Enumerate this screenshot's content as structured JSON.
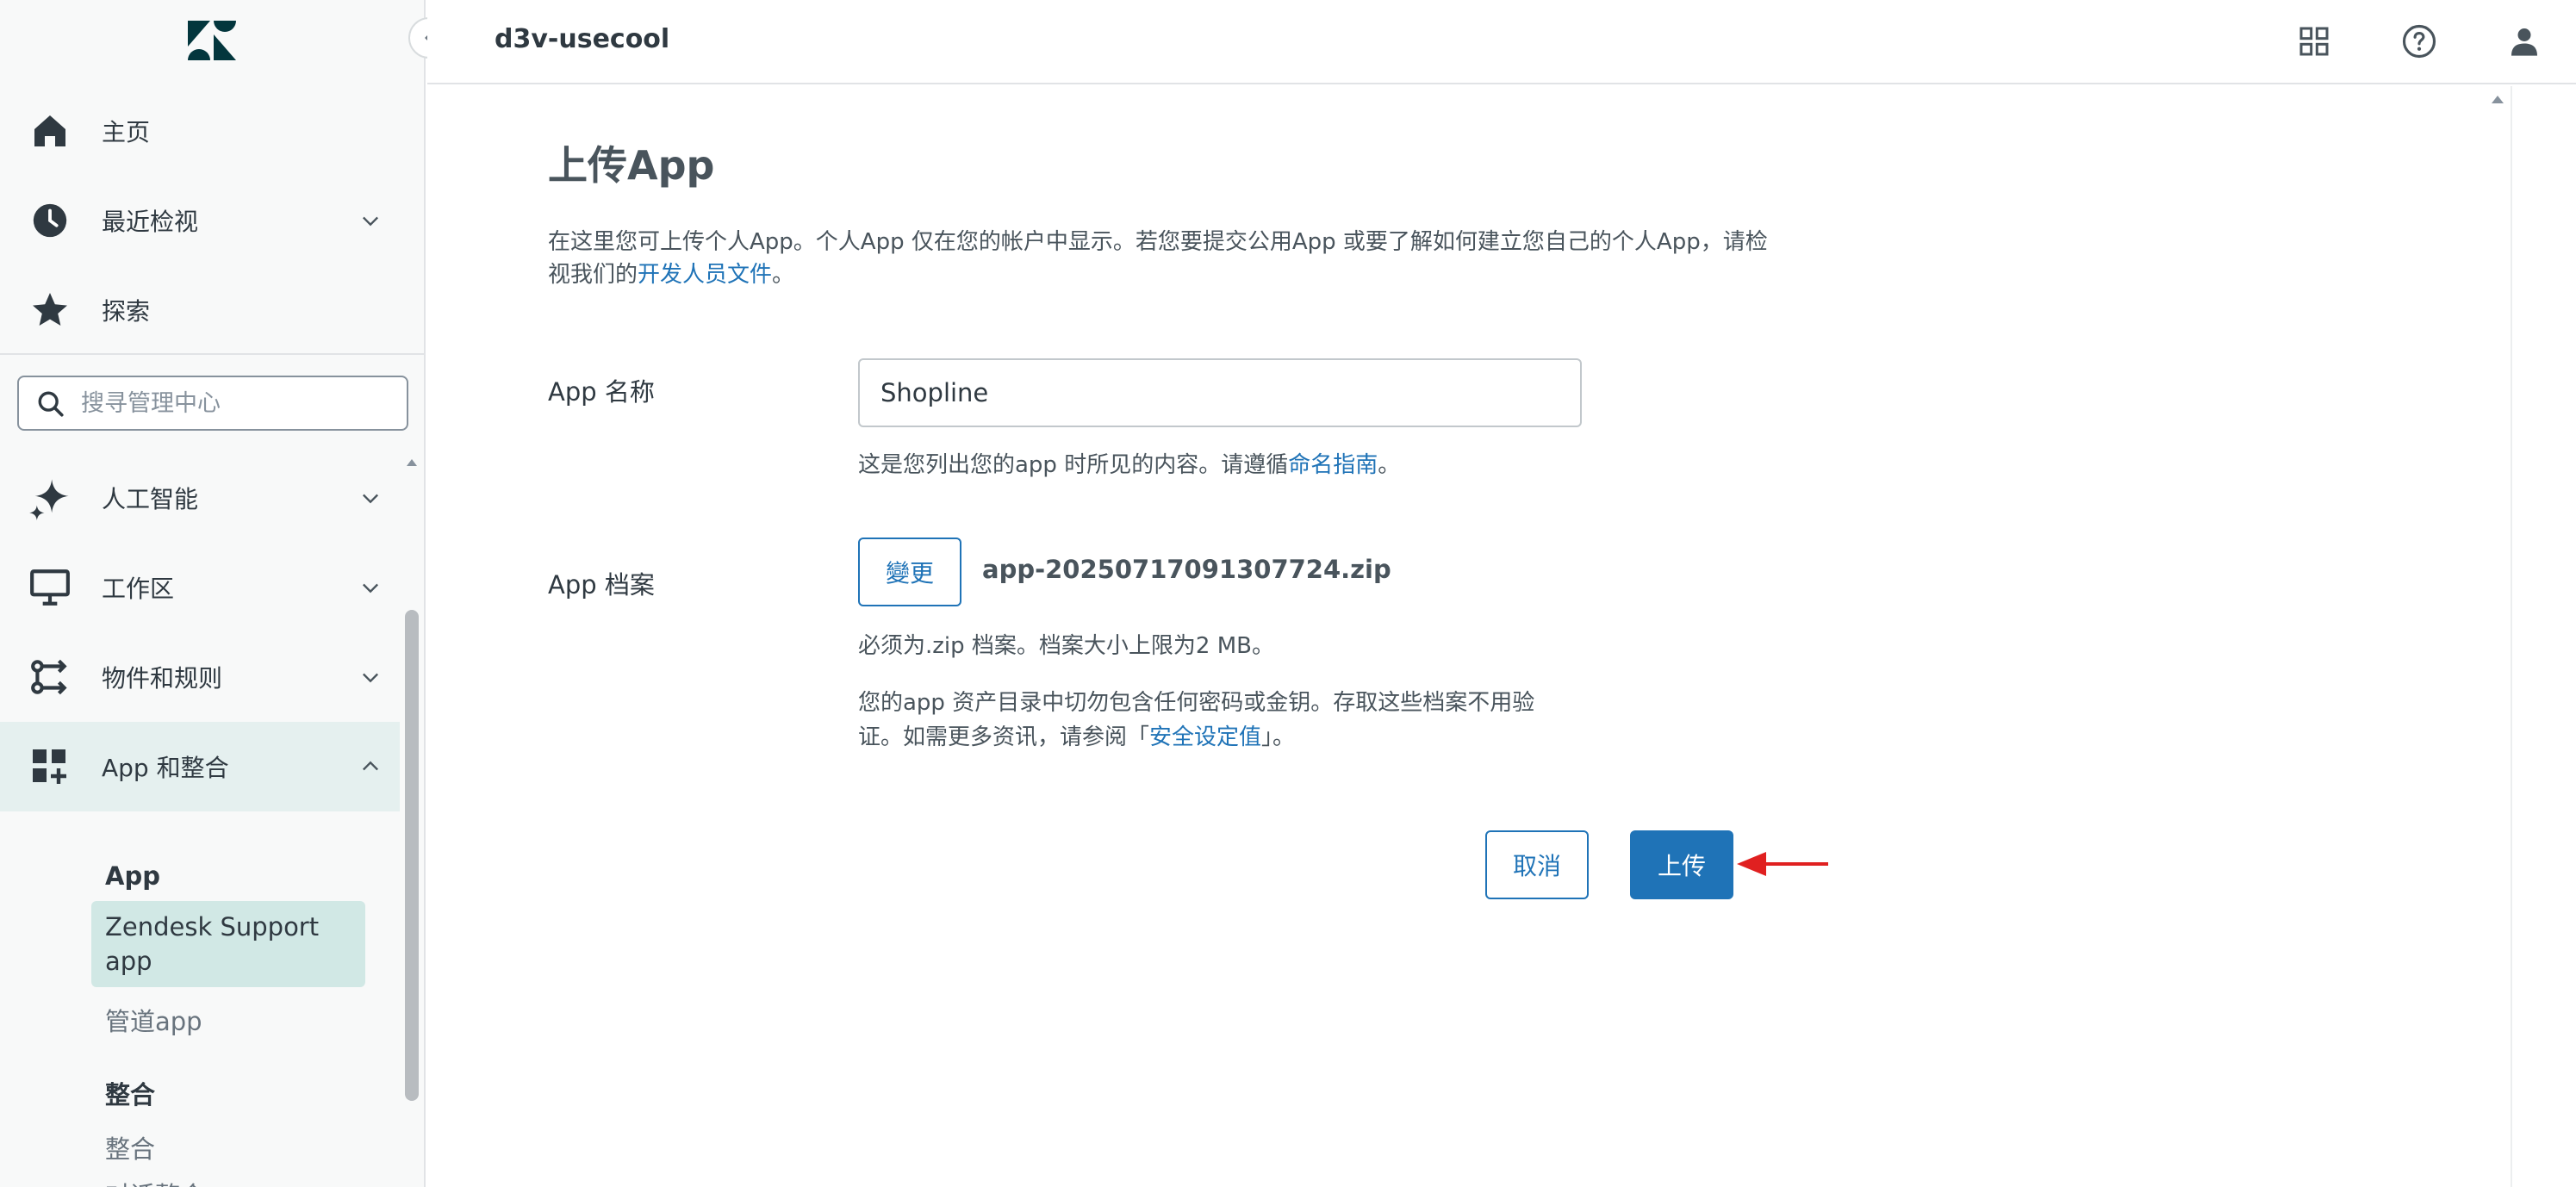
{
  "header": {
    "account_name": "d3v-usecool"
  },
  "sidebar": {
    "nav": [
      {
        "id": "home",
        "label": "主页",
        "icon": "home-icon"
      },
      {
        "id": "recent",
        "label": "最近检视",
        "icon": "clock-icon"
      },
      {
        "id": "explore",
        "label": "探索",
        "icon": "star-icon"
      }
    ],
    "search": {
      "placeholder": "搜寻管理中心"
    },
    "sections": [
      {
        "id": "ai",
        "label": "人工智能",
        "icon": "sparkle-icon"
      },
      {
        "id": "workspace",
        "label": "工作区",
        "icon": "monitor-icon"
      },
      {
        "id": "objects",
        "label": "物件和规则",
        "icon": "routing-icon"
      },
      {
        "id": "apps",
        "label": "App 和整合",
        "icon": "apps-add-icon",
        "expanded": true
      }
    ],
    "apps_group_title": "App",
    "apps_items": [
      "Zendesk Support app",
      "管道app"
    ],
    "integrations_group_title": "整合",
    "integrations_items": [
      "整合",
      "对话整合"
    ]
  },
  "main": {
    "title": "上传App",
    "intro_text": "在这里您可上传个人App。个人App 仅在您的帐户中显示。若您要提交公用App 或要了解如何建立您自己的个人App，请检视我们的",
    "intro_link": "开发人员文件",
    "intro_end": "。",
    "name_field": {
      "label": "App 名称",
      "value": "Shopline",
      "hint_text": "这是您列出您的app 时所见的内容。请遵循",
      "hint_link": "命名指南",
      "hint_end": "。"
    },
    "file_field": {
      "label": "App 档案",
      "change_label": "變更",
      "file_name": "app-20250717091307724.zip",
      "hint1": "必须为.zip 档案。档案大小上限为2 MB。",
      "hint2_text": "您的app 资产目录中切勿包含任何密码或金钥。存取这些档案不用验证。如需更多资讯，请参阅「",
      "hint2_link": "安全设定值",
      "hint2_end": "」。"
    },
    "cancel_label": "取消",
    "upload_label": "上传"
  },
  "colors": {
    "accent": "#1f73b7",
    "sidebar_bg": "#f8f9f9",
    "active_bg": "#e5f0ef",
    "selected_bg": "#d1e8e5",
    "arrow": "#e02020"
  }
}
